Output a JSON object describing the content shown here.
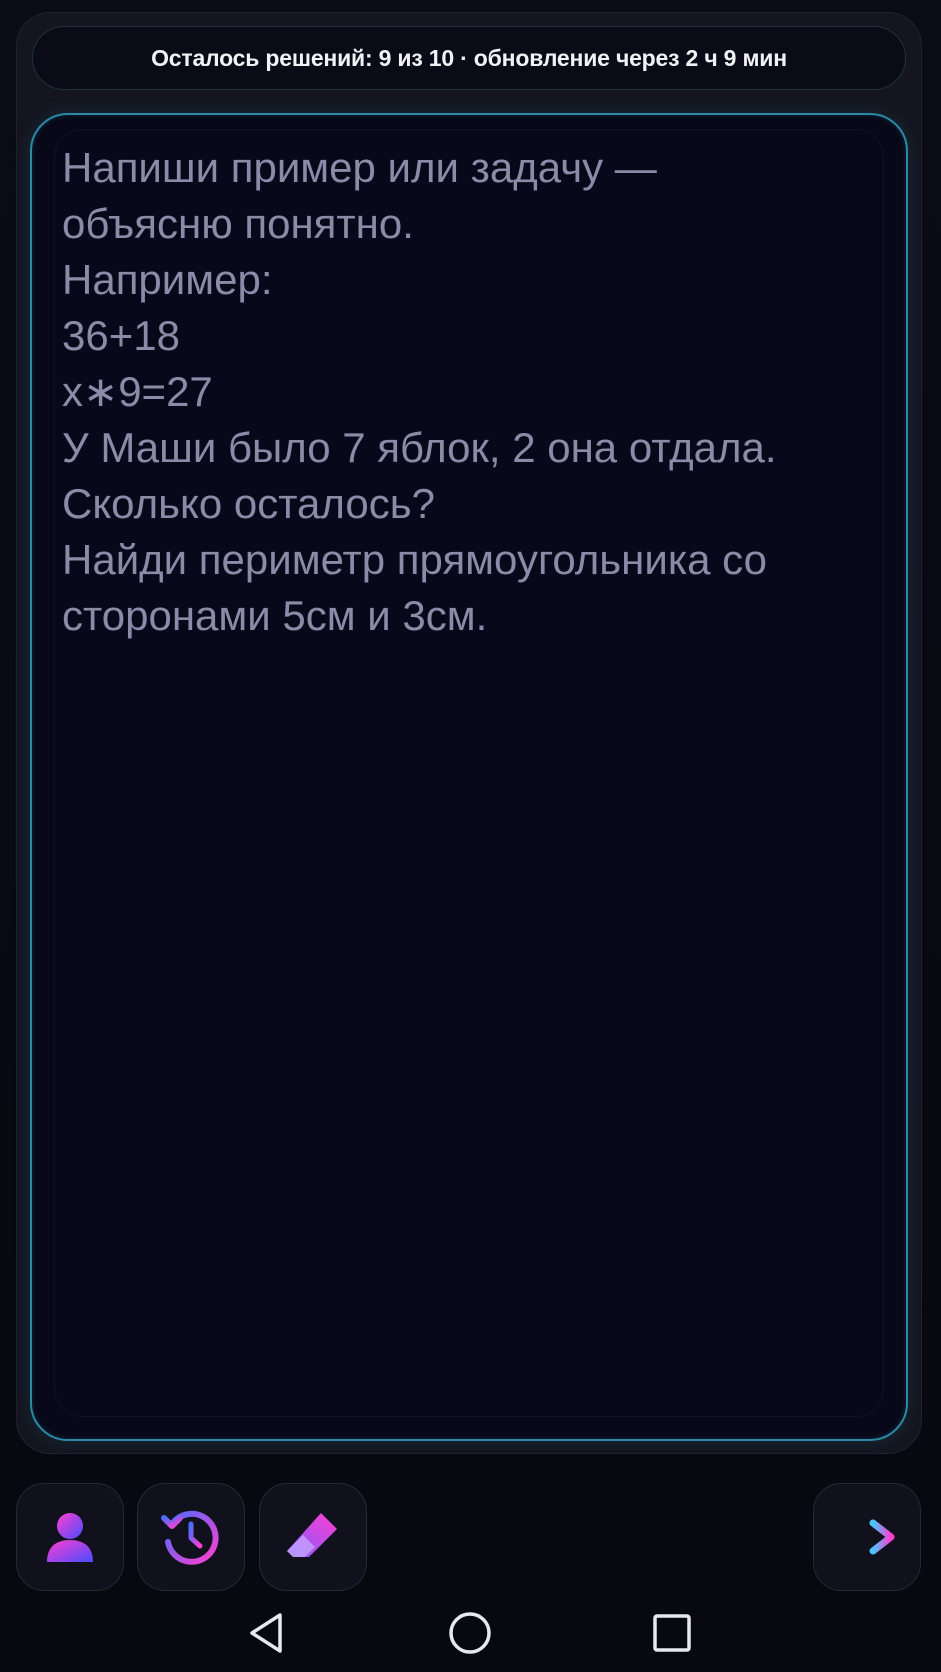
{
  "status": {
    "text": "Осталось решений: 9 из 10 · обновление через 2 ч 9 мин"
  },
  "input": {
    "placeholder": "Напиши пример или задачу —\nобъясню понятно.\nНапример:\n36+18\nx∗9=27\nУ Маши было 7 яблок, 2 она отдала.\nСколько осталось?\nНайди периметр прямоугольника со\nсторонами 5см и 3см."
  },
  "toolbar": {
    "icons": [
      "user-icon",
      "history-icon",
      "eraser-icon",
      "arrow-right-icon"
    ]
  },
  "system_nav": {
    "icons": [
      "back-icon",
      "home-icon",
      "recents-icon"
    ]
  },
  "colors": {
    "panel_border": "#2a8aa6",
    "accent_pink": "#e83bd8",
    "accent_blue": "#3b6bff"
  }
}
